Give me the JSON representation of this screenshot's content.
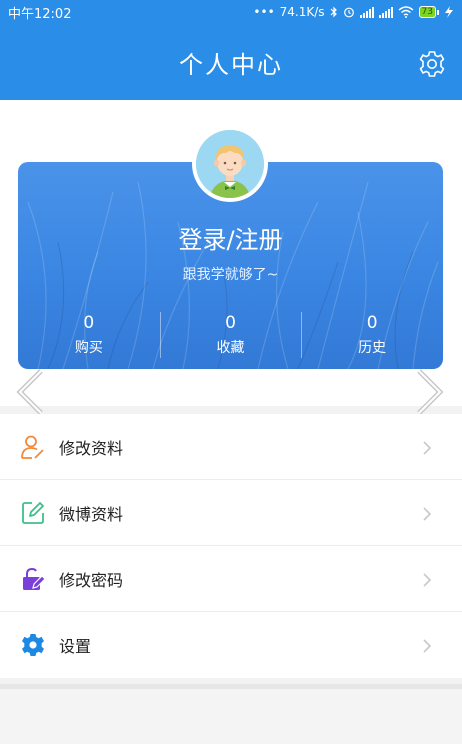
{
  "status_bar": {
    "time": "中午12:02",
    "dots": "•••",
    "net_speed": "74.1K/s",
    "battery_level": "73"
  },
  "header": {
    "title": "个人中心",
    "settings_icon": "gear-icon"
  },
  "profile_card": {
    "login_text": "登录/注册",
    "subtitle": "跟我学就够了~",
    "stats": [
      {
        "value": "0",
        "label": "购买"
      },
      {
        "value": "0",
        "label": "收藏"
      },
      {
        "value": "0",
        "label": "历史"
      }
    ]
  },
  "menu": {
    "items": [
      {
        "label": "修改资料",
        "icon": "user-edit-icon"
      },
      {
        "label": "微博资料",
        "icon": "note-edit-icon"
      },
      {
        "label": "修改密码",
        "icon": "lock-edit-icon"
      },
      {
        "label": "设置",
        "icon": "gear-icon"
      }
    ]
  },
  "colors": {
    "primary": "#2a8ee8",
    "card": "#3a86e2",
    "icon_orange": "#f08a3c",
    "icon_green": "#3cc08c",
    "icon_purple": "#7b3fd9",
    "icon_blue": "#1e88e5"
  }
}
